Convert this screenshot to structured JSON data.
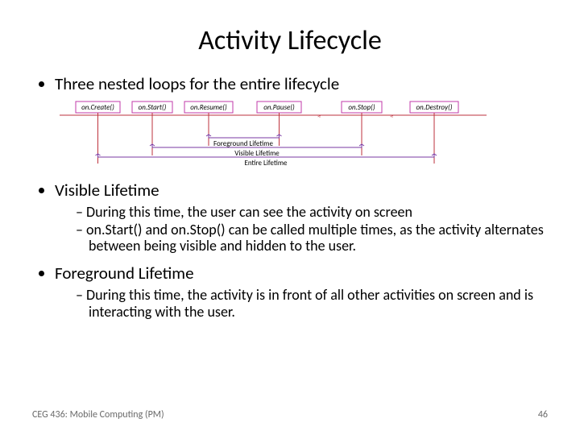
{
  "slide": {
    "title": "Activity Lifecycle",
    "bullet1": "Three nested loops for the entire lifecycle",
    "bullet2": "Visible Lifetime",
    "bullet2a": "During this time, the user can see the activity on screen",
    "bullet2b": "on.Start() and on.Stop() can be called multiple times, as the activity alternates between being visible and hidden to the user.",
    "bullet3": "Foreground Lifetime",
    "bullet3a": "During this time, the activity is in front of all other activities on screen and is interacting with the user."
  },
  "diagram": {
    "callbacks": [
      "on.Create()",
      "on.Start()",
      "on.Resume()",
      "on.Pause()",
      "on.Stop()",
      "on.Destroy()"
    ],
    "labels": {
      "foreground": "Foreground Lifetime",
      "visible": "Visible Lifetime",
      "entire": "Entire Lifetime"
    }
  },
  "footer": {
    "course": "CEG 436: Mobile Computing (PM)",
    "page": "46"
  },
  "colors": {
    "box_stroke": "#c03aa8",
    "axis_stroke": "#be323d",
    "bracket_stroke": "#7a3aa3"
  }
}
